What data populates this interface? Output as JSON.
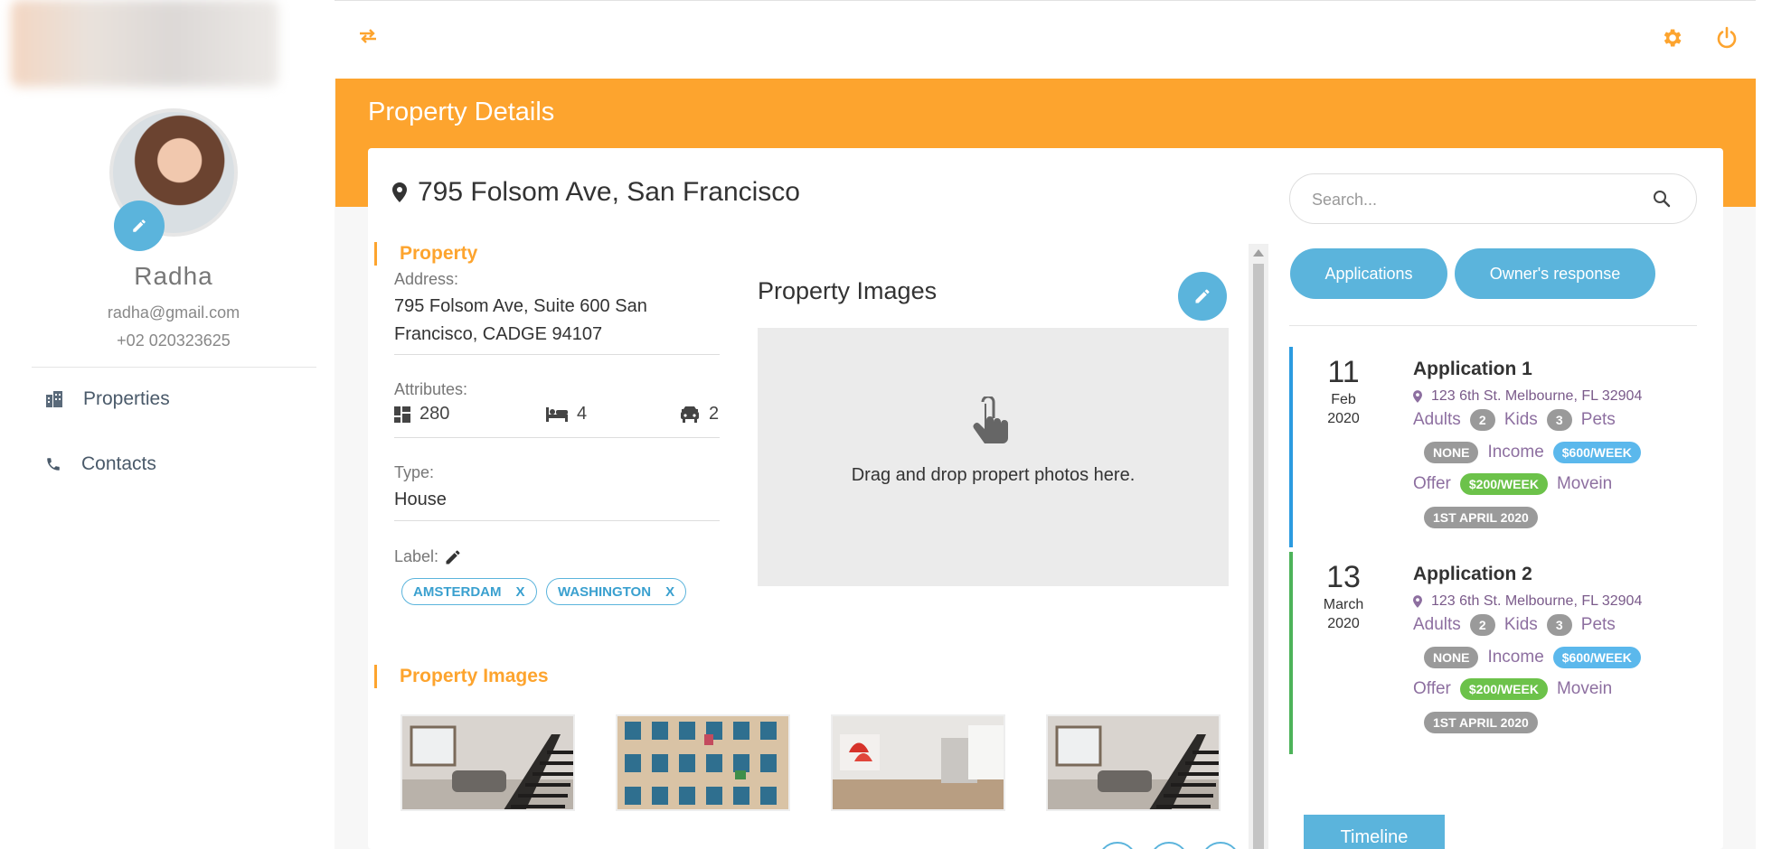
{
  "sidebar": {
    "user": {
      "name": "Radha",
      "email": "radha@gmail.com",
      "phone": "+02 020323625"
    },
    "nav": [
      {
        "label": "Properties",
        "icon": "building-icon"
      },
      {
        "label": "Contacts",
        "icon": "phone-icon"
      }
    ]
  },
  "header": {
    "page_title": "Property Details"
  },
  "property": {
    "title": "795 Folsom Ave, San Francisco",
    "section_title": "Property",
    "address_label": "Address:",
    "address_line1": "795 Folsom Ave, Suite 600 San",
    "address_line2": "Francisco, CADGE 94107",
    "attributes_label": "Attributes:",
    "area": "280",
    "beds": "4",
    "cars": "2",
    "type_label": "Type:",
    "type_value": "House",
    "label_label": "Label:",
    "tags": [
      {
        "text": "AMSTERDAM",
        "remove": "X"
      },
      {
        "text": "WASHINGTON",
        "remove": "X"
      }
    ],
    "images_section_title": "Property Images"
  },
  "images_panel": {
    "heading": "Property Images",
    "drop_text": "Drag and drop propert photos here."
  },
  "right_panel": {
    "search_placeholder": "Search...",
    "buttons": {
      "applications": "Applications",
      "owners_response": "Owner's response"
    },
    "applications": [
      {
        "day": "11",
        "month": "Feb",
        "year": "2020",
        "title": "Application 1",
        "address": "123 6th St. Melbourne, FL 32904",
        "adults_label": "Adults",
        "adults": "2",
        "kids_label": "Kids",
        "kids": "3",
        "pets_label": "Pets",
        "pets": "NONE",
        "income_label": "Income",
        "income": "$600/WEEK",
        "offer_label": "Offer",
        "offer": "$200/WEEK",
        "movein_label": "Movein",
        "movein": "1ST APRIL 2020",
        "accent": "#2b9be0"
      },
      {
        "day": "13",
        "month": "March",
        "year": "2020",
        "title": "Application 2",
        "address": "123 6th St. Melbourne, FL 32904",
        "adults_label": "Adults",
        "adults": "2",
        "kids_label": "Kids",
        "kids": "3",
        "pets_label": "Pets",
        "pets": "NONE",
        "income_label": "Income",
        "income": "$600/WEEK",
        "offer_label": "Offer",
        "offer": "$200/WEEK",
        "movein_label": "Movein",
        "movein": "1ST APRIL 2020",
        "accent": "#4db35a"
      }
    ],
    "timeline_button": "Timeline"
  },
  "colors": {
    "accent_orange": "#fda42e",
    "accent_blue": "#5bb4dc"
  }
}
